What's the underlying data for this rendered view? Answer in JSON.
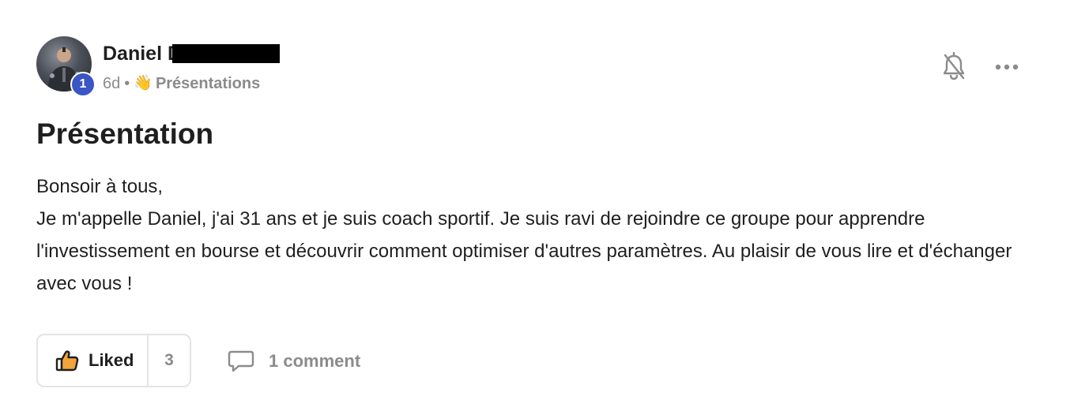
{
  "author": {
    "name": "Daniel D",
    "level": "1",
    "avatar_icon": "user-photo"
  },
  "meta": {
    "time_ago": "6d",
    "separator": "•",
    "category_emoji": "👋",
    "category": "Présentations"
  },
  "actions": {
    "notification_icon": "bell-off-icon",
    "more_icon": "more-horizontal-icon"
  },
  "post": {
    "title": "Présentation",
    "paragraphs": [
      "Bonsoir à tous,",
      "Je m'appelle Daniel, j'ai 31 ans et je suis coach sportif. Je suis ravi de rejoindre ce groupe pour apprendre l'investissement en bourse et découvrir comment optimiser d'autres paramètres. Au plaisir de vous lire et d'échanger avec vous !"
    ]
  },
  "footer": {
    "like_label": "Liked",
    "like_count": "3",
    "comment_label": "1 comment"
  },
  "colors": {
    "badge": "#3a55c4",
    "muted_text": "#8b8b8b",
    "border": "#e4e4e4"
  }
}
